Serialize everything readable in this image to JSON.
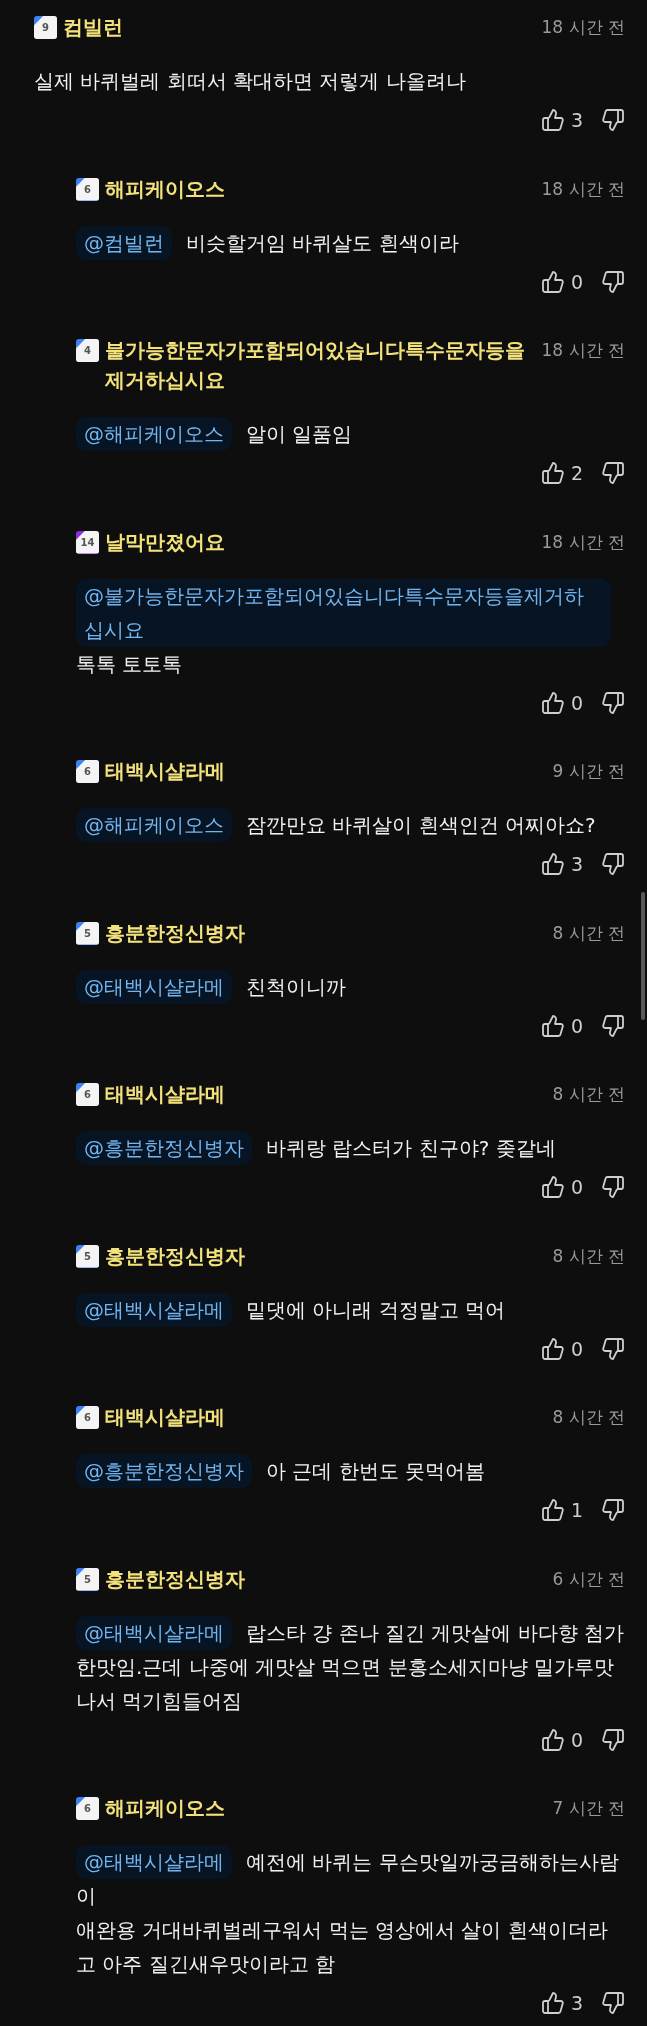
{
  "comments": [
    {
      "reply": false,
      "badge": "9",
      "color": "#3b82f6",
      "author": "컴빌런",
      "time": "18 시간 전",
      "text": "실제 바퀴벌레 회떠서 확대하면 저렇게 나올려나",
      "likes": "3"
    },
    {
      "reply": true,
      "badge": "6",
      "color": "#3b82f6",
      "author": "해피케이오스",
      "time": "18 시간 전",
      "mention": "@컴빌런",
      "text": "비슷할거임 바퀴살도 흰색이라",
      "likes": "0"
    },
    {
      "reply": true,
      "badge": "4",
      "color": "#3b82f6",
      "author": "불가능한문자가포함되어있습니다특수문자등을제거하십시요",
      "time": "18 시간 전",
      "mention": "@해피케이오스",
      "text": "알이 일품임",
      "likes": "2"
    },
    {
      "reply": true,
      "badge": "14",
      "color": "#8a2be2",
      "author": "날막만졌어요",
      "time": "18 시간 전",
      "mention": "@불가능한문자가포함되어있습니다특수문자등을제거하십시요",
      "text": "톡톡 토토톡",
      "likes": "0"
    },
    {
      "reply": true,
      "badge": "6",
      "color": "#3b82f6",
      "author": "태백시샬라메",
      "time": "9 시간 전",
      "mention": "@해피케이오스",
      "text": "잠깐만요 바퀴살이 흰색인건 어찌아쇼?",
      "likes": "3"
    },
    {
      "reply": true,
      "badge": "5",
      "color": "#3b82f6",
      "author": "흥분한정신병자",
      "time": "8 시간 전",
      "mention": "@태백시샬라메",
      "text": "친척이니까",
      "likes": "0"
    },
    {
      "reply": true,
      "badge": "6",
      "color": "#3b82f6",
      "author": "태백시샬라메",
      "time": "8 시간 전",
      "mention": "@흥분한정신병자",
      "text": "바퀴랑 랍스터가 친구야? 좆같네",
      "likes": "0"
    },
    {
      "reply": true,
      "badge": "5",
      "color": "#3b82f6",
      "author": "흥분한정신병자",
      "time": "8 시간 전",
      "mention": "@태백시샬라메",
      "text": "밑댓에 아니래 걱정말고 먹어",
      "likes": "0"
    },
    {
      "reply": true,
      "badge": "6",
      "color": "#3b82f6",
      "author": "태백시샬라메",
      "time": "8 시간 전",
      "mention": "@흥분한정신병자",
      "text": "아 근데 한번도 못먹어봄",
      "likes": "1"
    },
    {
      "reply": true,
      "badge": "5",
      "color": "#3b82f6",
      "author": "흥분한정신병자",
      "time": "6 시간 전",
      "mention": "@태백시샬라메",
      "text": "랍스타 걍 존나 질긴 게맛살에 바다향 첨가한맛임.근데 나중에 게맛살 먹으면 분홍소세지마냥 밀가루맛나서 먹기힘들어짐",
      "likes": "0"
    },
    {
      "reply": true,
      "badge": "6",
      "color": "#3b82f6",
      "author": "해피케이오스",
      "time": "7 시간 전",
      "mention": "@태백시샬라메",
      "text": "예전에 바퀴는 무슨맛일까궁금해하는사람이\n애완용 거대바퀴벌레구워서 먹는 영상에서 살이 흰색이더라고 아주 질긴새우맛이라고 함",
      "likes": "3"
    }
  ]
}
